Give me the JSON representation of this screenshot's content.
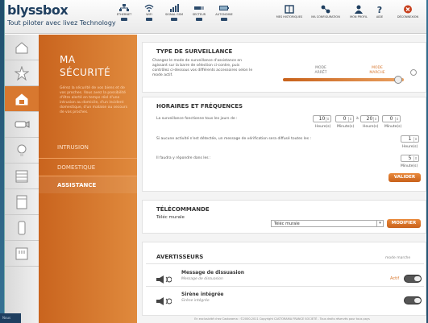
{
  "header": {
    "logo": "blyssbox",
    "tagline": "Tout piloter avec livez Technology",
    "status_icons": [
      {
        "icon": "ethernet-icon",
        "label": "ETHERNET"
      },
      {
        "icon": "wifi-icon",
        "label": "WIFI"
      },
      {
        "icon": "signal-icon",
        "label": "SIGNAL GSM"
      },
      {
        "icon": "power-icon",
        "label": "SECTEUR"
      },
      {
        "icon": "battery-icon",
        "label": "AUTONOMIE"
      }
    ],
    "nav": [
      {
        "icon": "history-icon",
        "label": "MES HISTORIQUES"
      },
      {
        "icon": "config-icon",
        "label": "MA CONFIGURATION"
      },
      {
        "icon": "profile-icon",
        "label": "MON PROFIL"
      },
      {
        "icon": "help-icon",
        "label": "AIDE"
      },
      {
        "icon": "logout-icon",
        "label": "DÉCONNEXION"
      }
    ]
  },
  "sidebar": {
    "items": [
      {
        "icon": "home-icon"
      },
      {
        "icon": "star-icon"
      },
      {
        "icon": "security-house-icon"
      },
      {
        "icon": "camera-icon"
      },
      {
        "icon": "bulb-icon"
      },
      {
        "icon": "shutter-icon"
      },
      {
        "icon": "door-icon"
      },
      {
        "icon": "device-icon"
      },
      {
        "icon": "power-plug-icon"
      }
    ]
  },
  "panel": {
    "title_line1": "MA",
    "title_line2": "SÉCURITÉ",
    "description": "Gérez la sécurité de vos biens et de vos proches. Vous avez la possibilité d'être alerté en temps réel d'une intrusion au domicile, d'un incident domestique, d'un malaise ou secours de vos proches.",
    "menu": [
      "INTRUSION",
      "DOMESTIQUE",
      "ASSISTANCE"
    ]
  },
  "surveillance": {
    "title": "TYPE DE SURVEILLANCE",
    "description": "Changez le mode de surveillance d'assistance en agissant sur la barre de sélection ci-contre, puis contrôlez ci-dessous vos différents accessoires selon le mode actif.",
    "mode_off_line1": "MODE",
    "mode_off_line2": "ARRÊT",
    "mode_on_line1": "MODE",
    "mode_on_line2": "MARCHE",
    "slider_value": 0.9
  },
  "horaires": {
    "title": "HORAIRES ET FRÉQUENCES",
    "row1_label": "La surveillance fonctionne tous les jours de :",
    "from_h": "10",
    "from_m": "0",
    "a": "à",
    "to_h": "20",
    "to_m": "0",
    "unit_h": "Heure(s)",
    "unit_m": "Minute(s)",
    "row2_label": "Si aucune activité n'est détectée, un message de vérification sera diffusé toutes les :",
    "every_h": "1",
    "row3_label": "Il faudra y répondre dans les :",
    "reply_m": "5",
    "validate": "VALIDER"
  },
  "telecommande": {
    "title": "TÉLÉCOMMANDE",
    "label": "Téléc murale",
    "selected": "Téléc murale",
    "modify": "MODIFIER"
  },
  "avertisseurs": {
    "title": "AVERTISSEURS",
    "mode_label": "mode marche",
    "items": [
      {
        "name": "Message de dissuasion",
        "sub": "Message de dissuasion",
        "status": "Actif"
      },
      {
        "name": "Sirène intégrée",
        "sub": "Sirène intégrée",
        "status": ""
      }
    ]
  },
  "footer": {
    "text": "En exclusivité chez Castorama : ©2000-2011 Copyright CASTORAMA FRANCE SOCIETÉ - Tous droits réservés pour tous pays"
  },
  "corner_label": "Nous",
  "colors": {
    "accent": "#d8782f",
    "navy": "#1f3f60"
  }
}
